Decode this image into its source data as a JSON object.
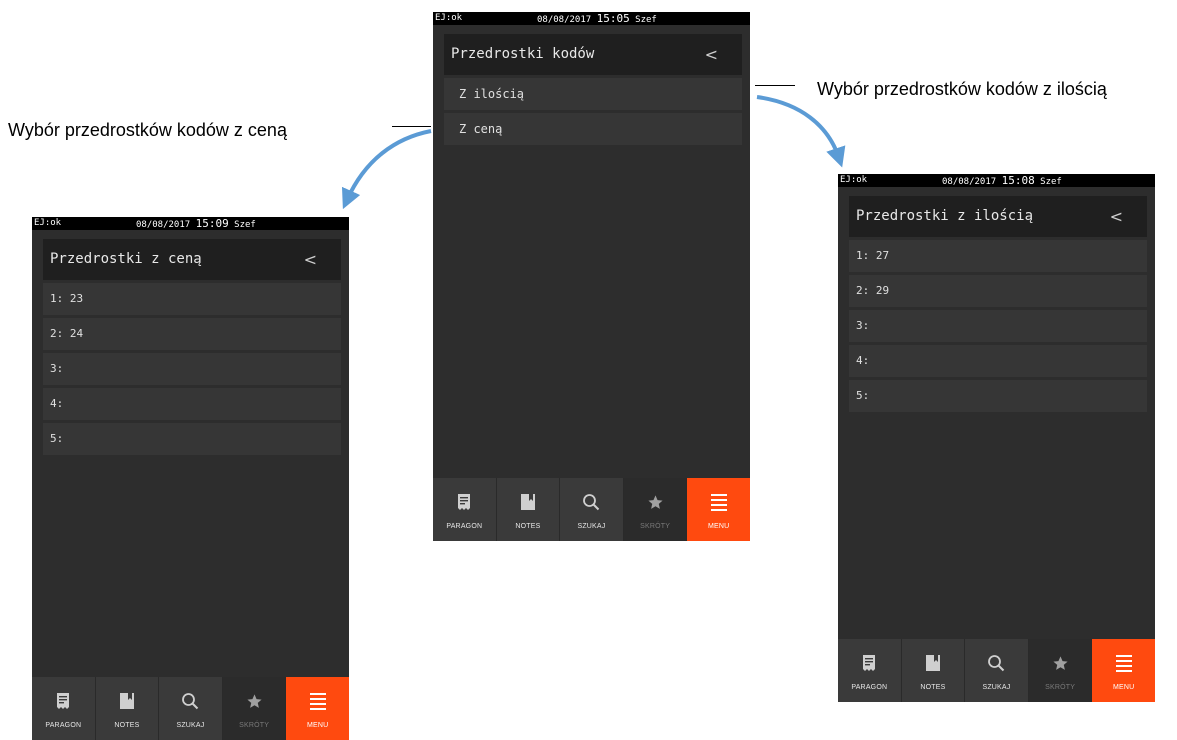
{
  "captions": {
    "left": "Wybór przedrostków kodów z ceną",
    "right": "Wybór przedrostków kodów z ilością"
  },
  "colors": {
    "arrow": "#5b9bd5",
    "menu_accent": "#ff4a0f",
    "screen_bg": "#2d2d2d"
  },
  "tabbar": {
    "tabs": [
      {
        "label": "PARAGON",
        "icon": "receipt-icon"
      },
      {
        "label": "NOTES",
        "icon": "notebook-icon"
      },
      {
        "label": "SZUKAJ",
        "icon": "search-icon"
      },
      {
        "label": "SKRÓTY",
        "icon": "star-icon",
        "disabled": true
      },
      {
        "label": "MENU",
        "icon": "menu-icon",
        "active": true
      }
    ]
  },
  "screens": {
    "center": {
      "status": {
        "ej": "EJ:ok",
        "date": "08/08/2017",
        "time": "15:05",
        "user": "Szef"
      },
      "title": "Przedrostki kodów",
      "back": "<",
      "items": [
        "Z ilością",
        "Z ceną"
      ]
    },
    "left": {
      "status": {
        "ej": "EJ:ok",
        "date": "08/08/2017",
        "time": "15:09",
        "user": "Szef"
      },
      "title": "Przedrostki z ceną",
      "back": "<",
      "items": [
        "1: 23",
        "2: 24",
        "3:",
        "4:",
        "5:"
      ]
    },
    "right": {
      "status": {
        "ej": "EJ:ok",
        "date": "08/08/2017",
        "time": "15:08",
        "user": "Szef"
      },
      "title": "Przedrostki z ilością",
      "back": "<",
      "items": [
        "1: 27",
        "2: 29",
        "3:",
        "4:",
        "5:"
      ]
    }
  }
}
